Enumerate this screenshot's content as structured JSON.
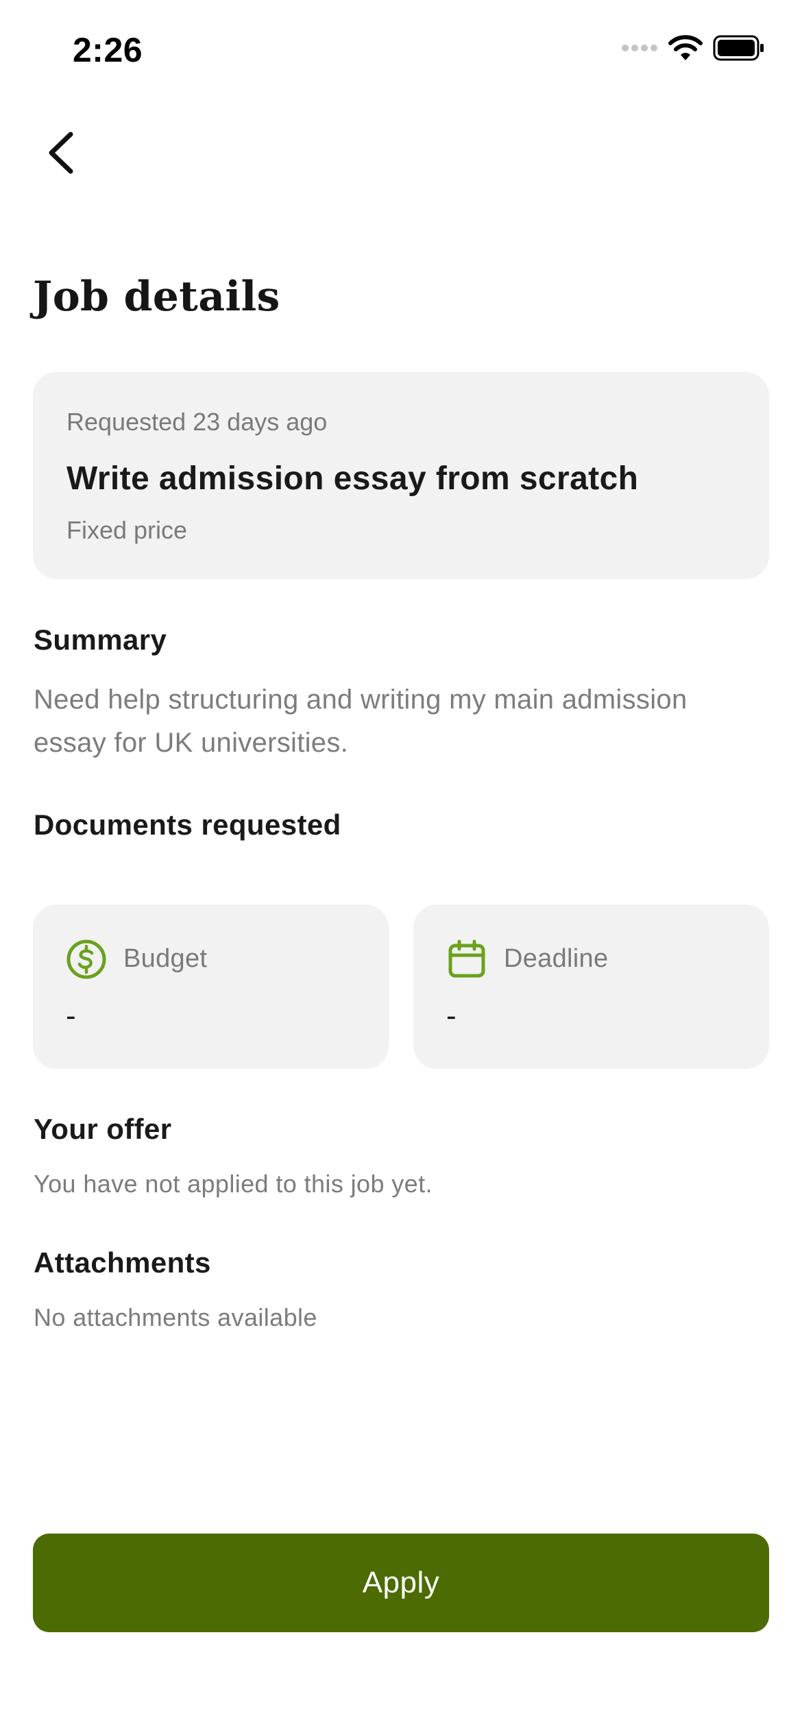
{
  "status_bar": {
    "time": "2:26",
    "signal_icon": "signal-dots-icon",
    "wifi_icon": "wifi-icon",
    "battery_icon": "battery-icon"
  },
  "nav": {
    "back_icon": "chevron-left-icon"
  },
  "page": {
    "title": "Job details"
  },
  "job": {
    "requested": "Requested 23 days ago",
    "title": "Write admission essay from scratch",
    "pricing": "Fixed price"
  },
  "summary": {
    "heading": "Summary",
    "text": "Need help structuring and writing my main admission essay for UK universities."
  },
  "documents": {
    "heading": "Documents requested"
  },
  "budget": {
    "icon": "dollar-circle-icon",
    "label": "Budget",
    "value": "-"
  },
  "deadline": {
    "icon": "calendar-icon",
    "label": "Deadline",
    "value": "-"
  },
  "offer": {
    "heading": "Your offer",
    "text": "You have not applied to this job yet."
  },
  "attachments": {
    "heading": "Attachments",
    "text": "No attachments available"
  },
  "actions": {
    "apply_label": "Apply"
  },
  "colors": {
    "accent": "#4c6b02",
    "icon_green": "#6aa11e",
    "card_bg": "#f2f2f2",
    "muted_text": "#7c7c7c"
  }
}
